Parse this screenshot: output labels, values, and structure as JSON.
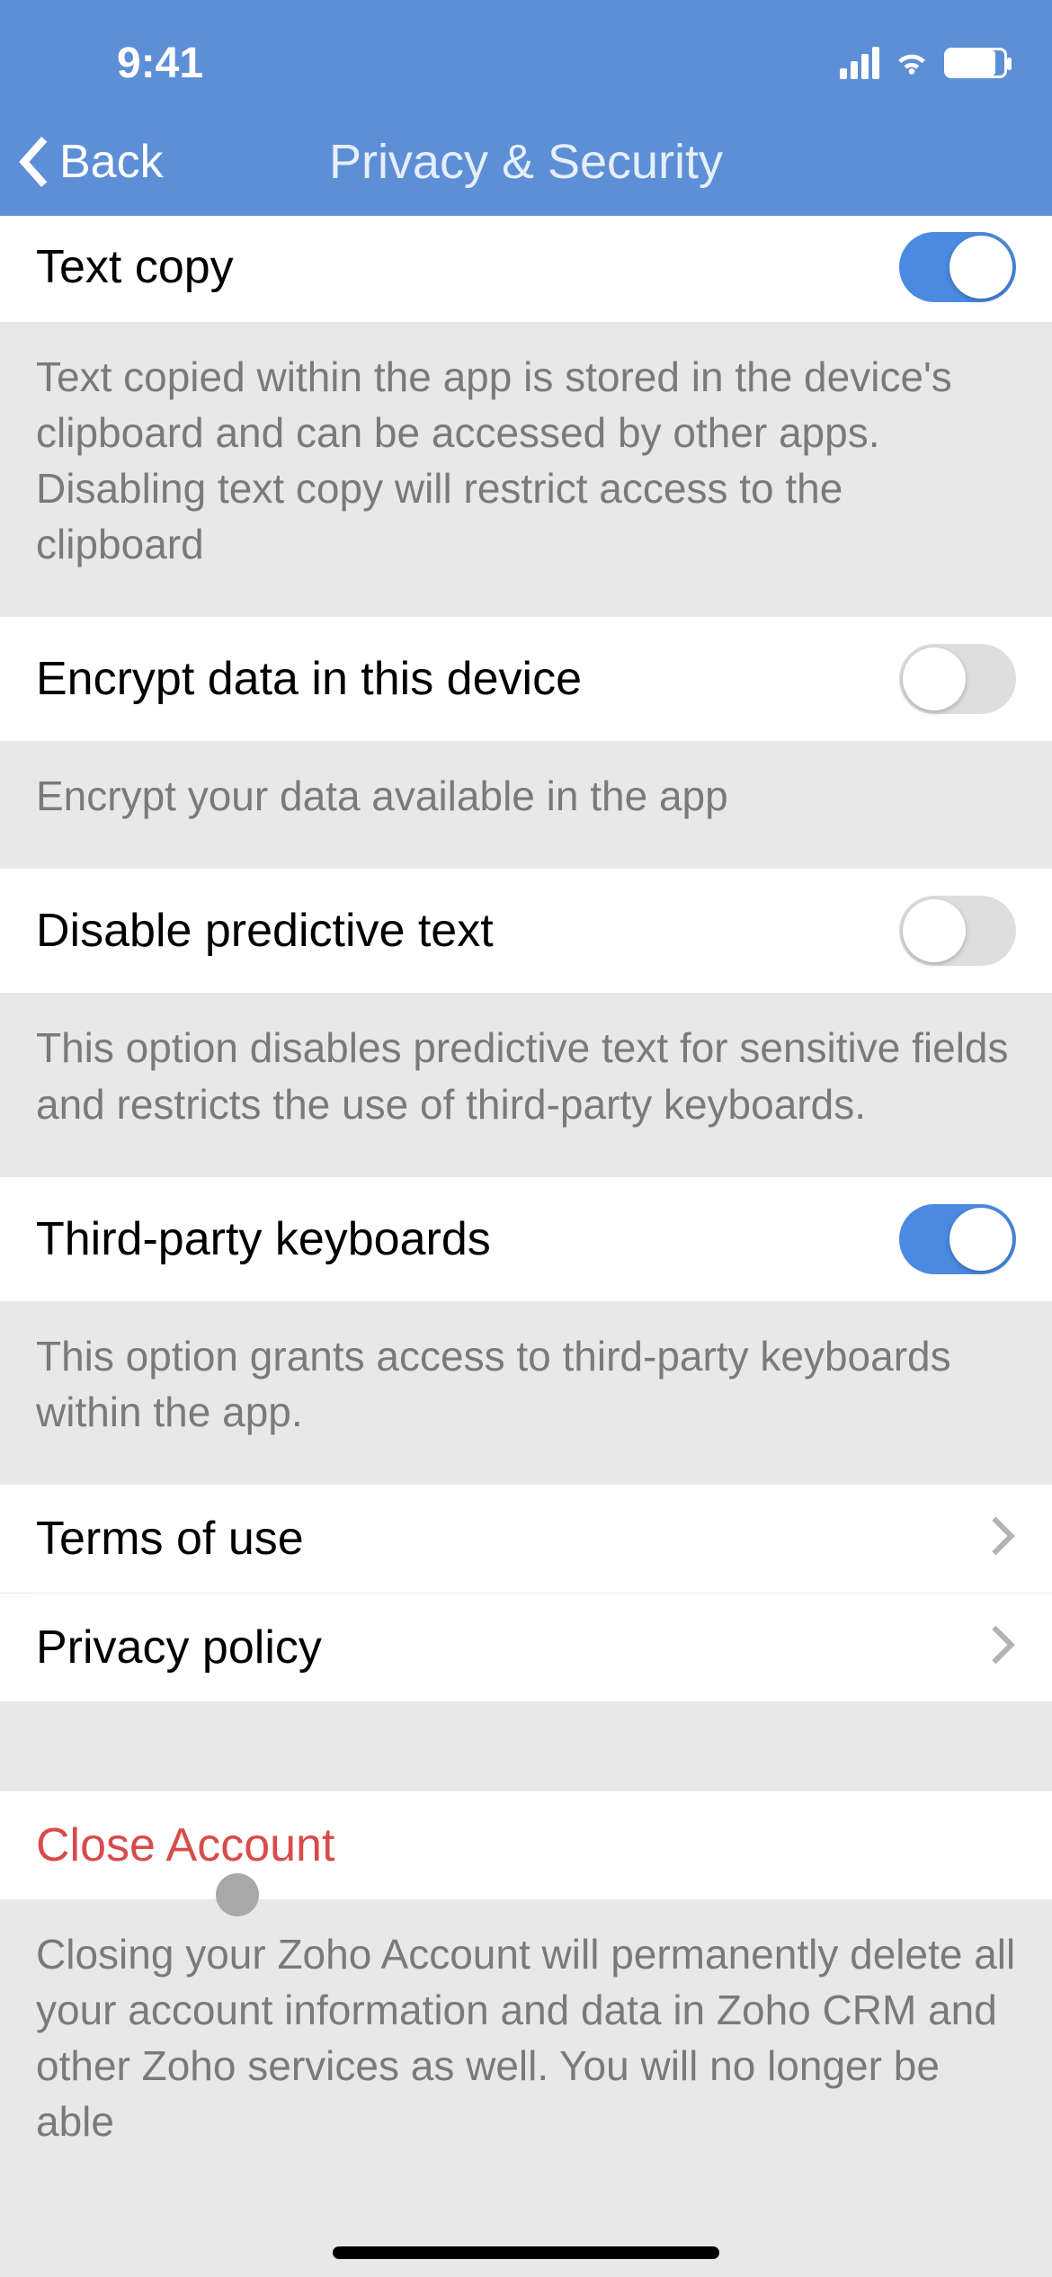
{
  "status": {
    "time": "9:41"
  },
  "nav": {
    "back": "Back",
    "title": "Privacy & Security"
  },
  "rows": {
    "text_copy": {
      "label": "Text copy",
      "on": true,
      "footer": "Text copied within the app is stored in the device's clipboard and can be accessed by other apps. Disabling text copy will restrict access to the clipboard"
    },
    "encrypt": {
      "label": "Encrypt data in this device",
      "on": false,
      "footer": "Encrypt your data available in the app"
    },
    "predictive": {
      "label": "Disable predictive text",
      "on": false,
      "footer": "This option disables predictive text for sensitive fields and restricts the use of third-party keyboards."
    },
    "third_party": {
      "label": "Third-party keyboards",
      "on": true,
      "footer": "This option grants access to third-party keyboards within the app."
    },
    "terms": {
      "label": "Terms of use"
    },
    "privacy": {
      "label": "Privacy policy"
    },
    "close_account": {
      "label": "Close Account",
      "footer": "Closing your Zoho Account will permanently delete all your account information and data in Zoho CRM and other Zoho services as well. You will no longer be able"
    }
  }
}
